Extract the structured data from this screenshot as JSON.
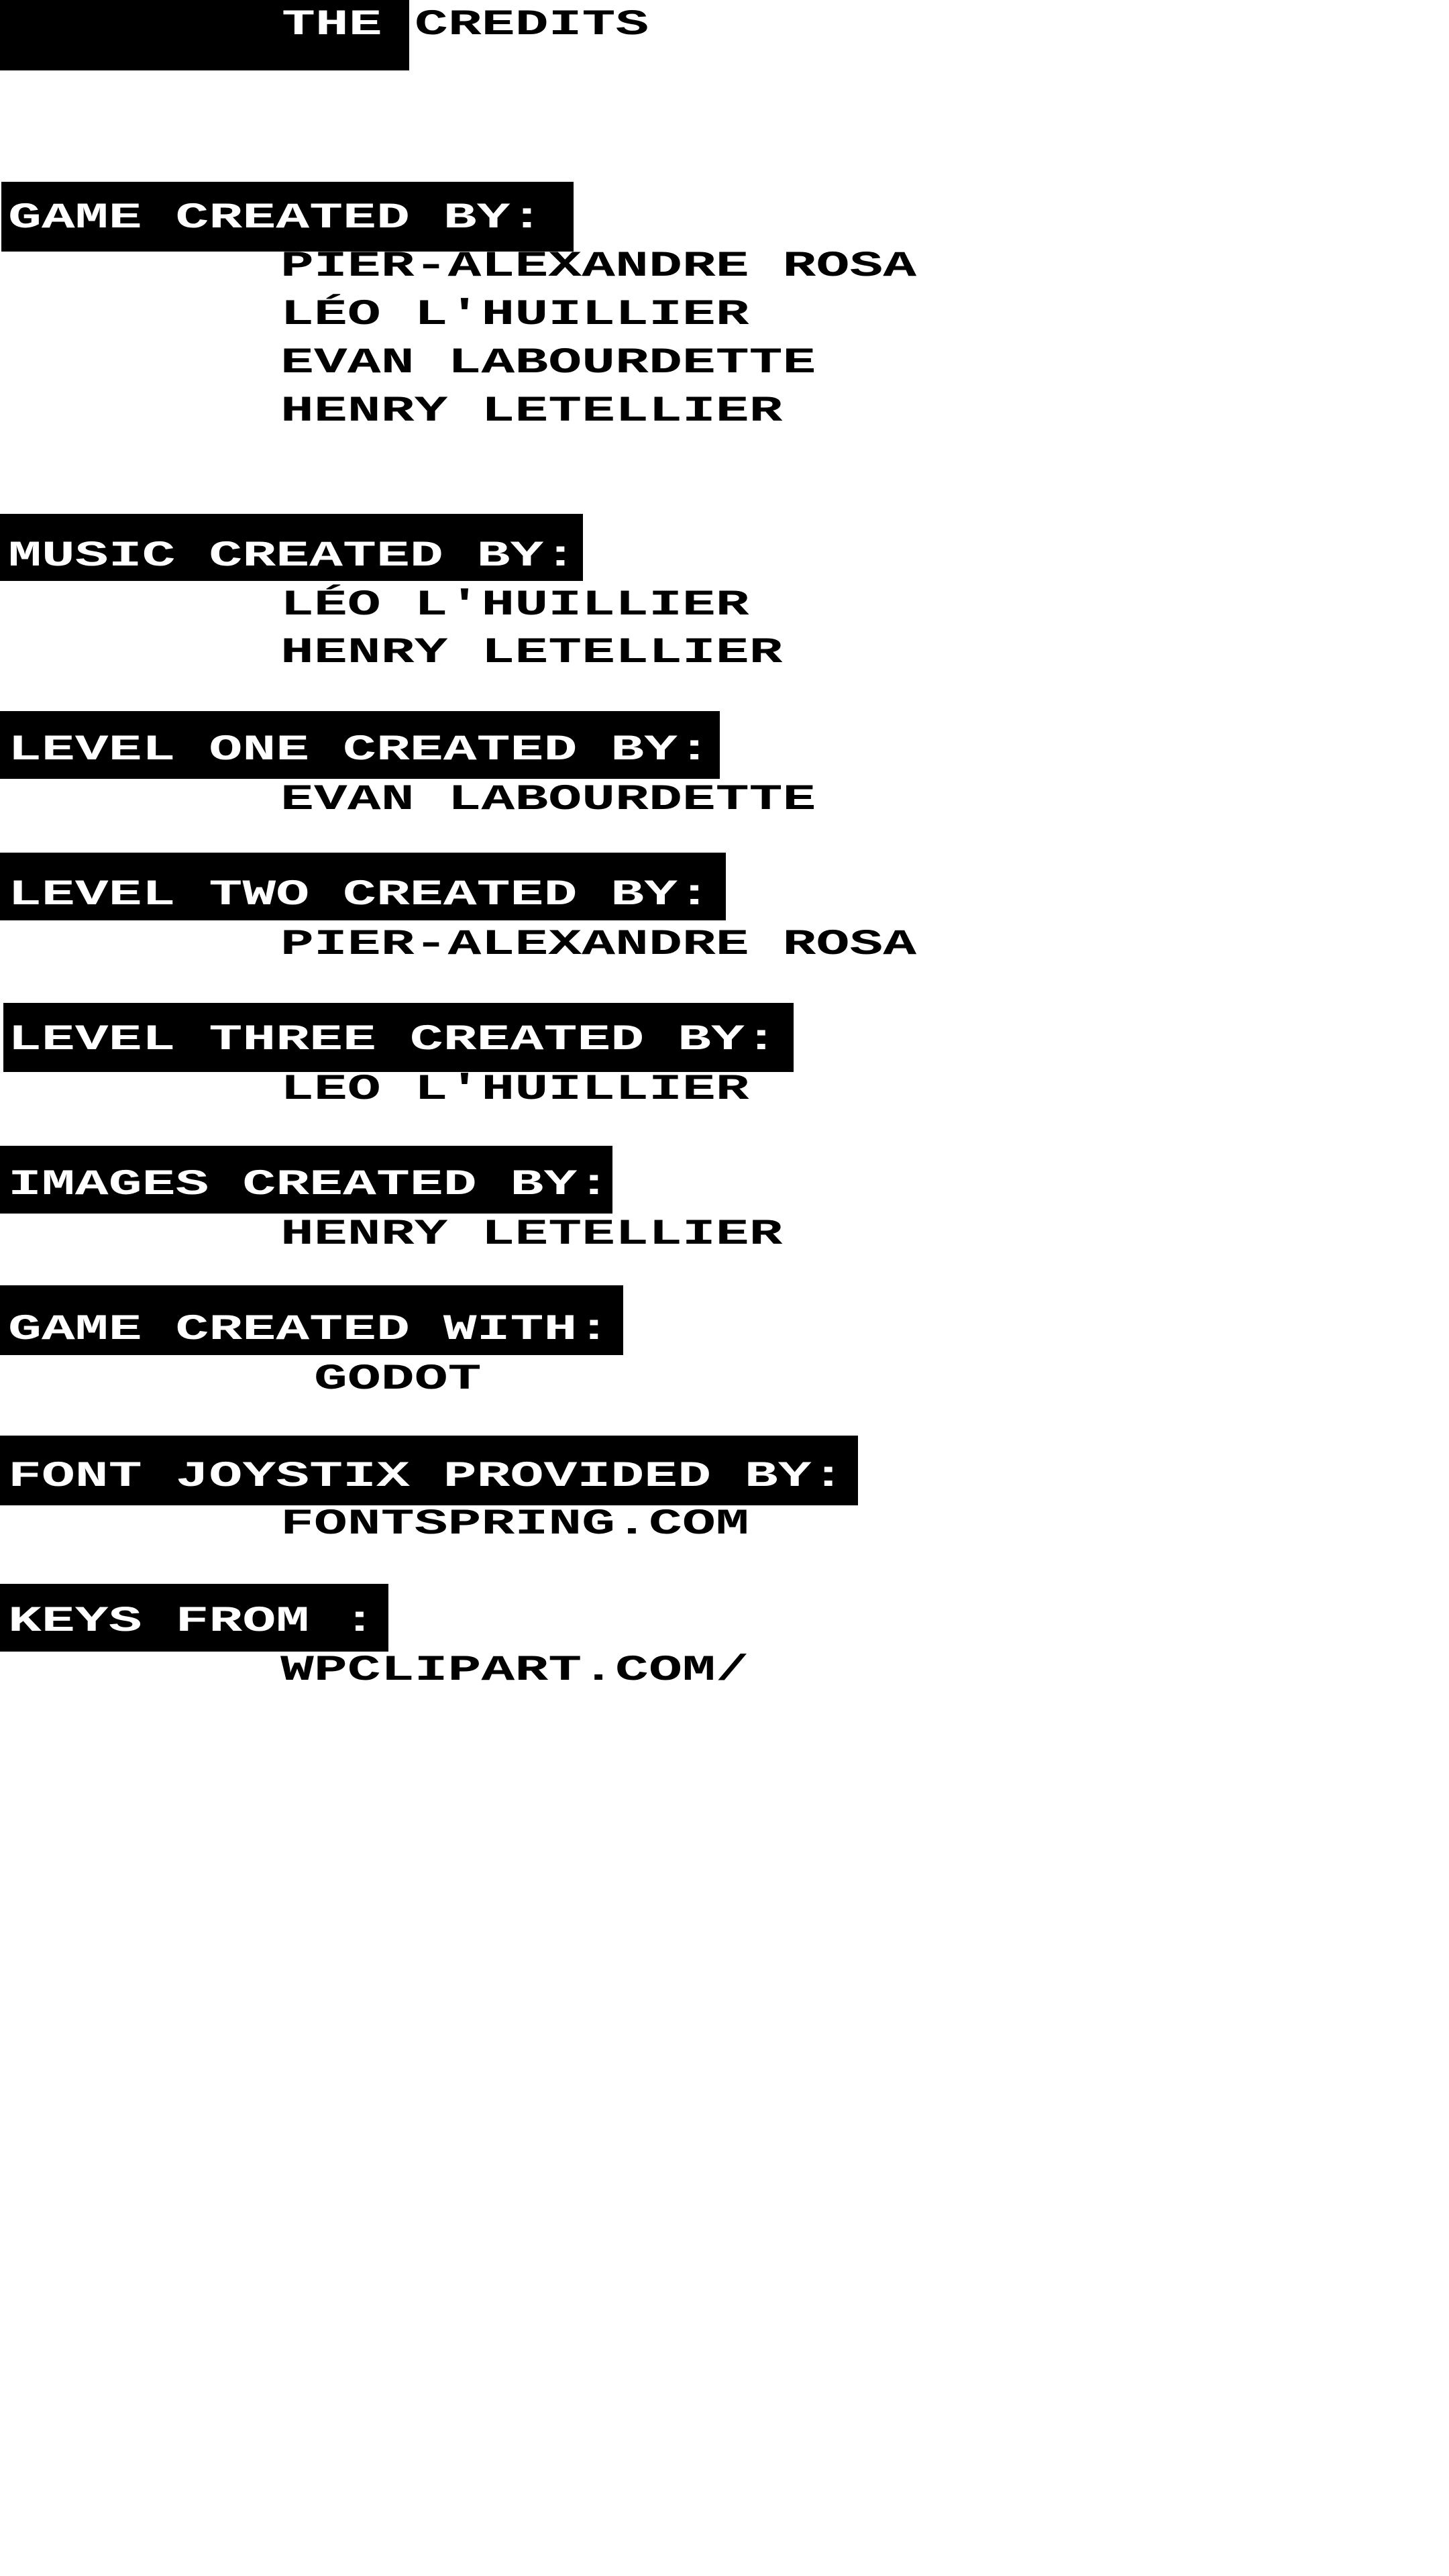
{
  "title": {
    "part1": "THE",
    "part2": "CREDITS"
  },
  "sections": [
    {
      "heading": "GAME CREATED BY:",
      "entries": [
        "PIER-ALEXANDRE ROSA",
        "LÉO L'HUILLIER",
        "EVAN LABOURDETTE",
        "HENRY LETELLIER"
      ]
    },
    {
      "heading": "MUSIC CREATED BY:",
      "entries": [
        "LÉO L'HUILLIER",
        "HENRY LETELLIER"
      ]
    },
    {
      "heading": "LEVEL ONE CREATED BY:",
      "entries": [
        "EVAN LABOURDETTE"
      ]
    },
    {
      "heading": "LEVEL TWO CREATED BY:",
      "entries": [
        "PIER-ALEXANDRE ROSA"
      ]
    },
    {
      "heading": "LEVEL THREE CREATED BY:",
      "entries": [
        "LEO L'HUILLIER"
      ]
    },
    {
      "heading": "IMAGES CREATED BY:",
      "entries": [
        "HENRY LETELLIER"
      ]
    },
    {
      "heading": "GAME CREATED WITH:",
      "entries": [
        "GODOT"
      ]
    },
    {
      "heading": "FONT JOYSTIX PROVIDED BY:",
      "entries": [
        "FONTSPRING.COM"
      ]
    },
    {
      "heading": "KEYS FROM :",
      "entries": [
        "WPCLIPART.COM/"
      ]
    }
  ],
  "colors": {
    "background": "#ffffff",
    "text": "#000000",
    "highlight": "#000000",
    "highlight_text": "#ffffff"
  }
}
